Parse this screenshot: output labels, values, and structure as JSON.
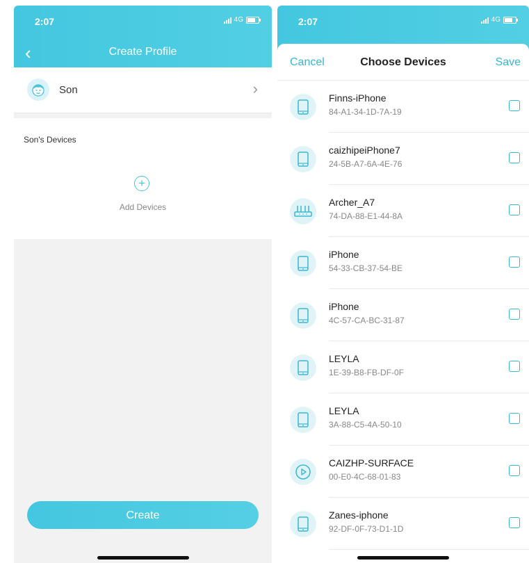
{
  "left": {
    "time": "2:07",
    "network": "4G",
    "title": "Create Profile",
    "profile_name": "Son",
    "devices_title": "Son's Devices",
    "add_devices_label": "Add Devices",
    "create_label": "Create"
  },
  "right": {
    "time": "2:07",
    "network": "4G",
    "cancel_label": "Cancel",
    "title": "Choose Devices",
    "save_label": "Save",
    "devices": [
      {
        "name": "Finns-iPhone",
        "mac": "84-A1-34-1D-7A-19",
        "icon": "phone-icon",
        "checked": false
      },
      {
        "name": "caizhipeiPhone7",
        "mac": "24-5B-A7-6A-4E-76",
        "icon": "phone-icon",
        "checked": false
      },
      {
        "name": "Archer_A7",
        "mac": "74-DA-88-E1-44-8A",
        "icon": "router-icon",
        "checked": false
      },
      {
        "name": "iPhone",
        "mac": "54-33-CB-37-54-BE",
        "icon": "phone-icon",
        "checked": false
      },
      {
        "name": "iPhone",
        "mac": "4C-57-CA-BC-31-87",
        "icon": "phone-icon",
        "checked": false
      },
      {
        "name": "LEYLA",
        "mac": "1E-39-B8-FB-DF-0F",
        "icon": "phone-icon",
        "checked": false
      },
      {
        "name": "LEYLA",
        "mac": "3A-88-C5-4A-50-10",
        "icon": "phone-icon",
        "checked": false
      },
      {
        "name": "CAIZHP-SURFACE",
        "mac": "00-E0-4C-68-01-83",
        "icon": "media-player-icon",
        "checked": false
      },
      {
        "name": "Zanes-iphone",
        "mac": "92-DF-0F-73-D1-1D",
        "icon": "phone-icon",
        "checked": false
      }
    ]
  },
  "colors": {
    "accent": "#43c7e0",
    "link": "#37b6d2"
  }
}
